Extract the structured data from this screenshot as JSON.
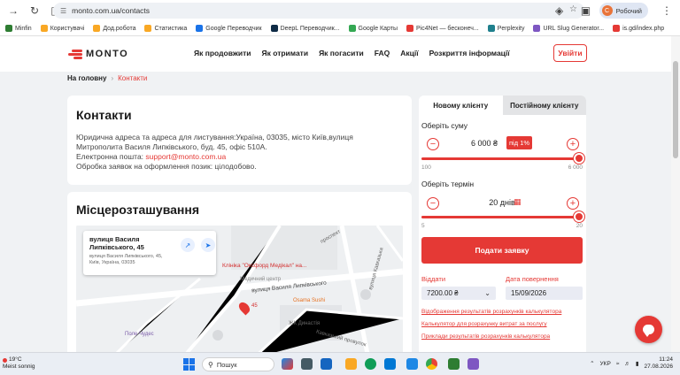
{
  "browser": {
    "url": "monto.com.ua/contacts",
    "profile_initial": "С",
    "profile_label": "Робочий"
  },
  "bookmarks": [
    {
      "label": "Minfin",
      "color": "#2e7d32"
    },
    {
      "label": "Користувачі",
      "color": "#f9a825"
    },
    {
      "label": "Дод.робота",
      "color": "#f9a825"
    },
    {
      "label": "Статистика",
      "color": "#f9a825"
    },
    {
      "label": "Google Переводчик",
      "color": "#1a73e8"
    },
    {
      "label": "DeepL Переводчик...",
      "color": "#0f2b46"
    },
    {
      "label": "Google Карты",
      "color": "#34a853"
    },
    {
      "label": "Pic4Net — бесконеч...",
      "color": "#e53935"
    },
    {
      "label": "Perplexity",
      "color": "#20808d"
    },
    {
      "label": "URL Slug Generator...",
      "color": "#7e57c2"
    },
    {
      "label": "is.gd/index.php",
      "color": "#e53935"
    }
  ],
  "header": {
    "logo_text": "MONTO",
    "nav": [
      "Як продовжити",
      "Як отримати",
      "Як погасити",
      "FAQ",
      "Акції",
      "Розкриття інформації"
    ],
    "login_label": "Увійти"
  },
  "breadcrumb": {
    "home": "На головну",
    "separator": "›",
    "current": "Контакти"
  },
  "contacts": {
    "title": "Контакти",
    "address_line1": "Юридична адреса та адреса для листування:Україна, 03035, місто Київ,вулиця",
    "address_line2": "Митрополита Василя Липківського, буд. 45, офіс 510А.",
    "email_label": "Електронна пошта: ",
    "email": "support@monto.com.ua",
    "hours": "Обробка заявок на оформлення позик: цілодобово."
  },
  "location": {
    "title": "Місцерозташування",
    "map": {
      "place_title": "вулиця Василя Липківського, 45",
      "place_address": "вулиця Василя Липківського, 45, Київ, Україна, 03035",
      "clinic": "Клініка \"Оксфорд Медікал\" на...",
      "clinic_sub": "Медичний центр",
      "street": "вулиця Василя Липківського",
      "pin_number": "45",
      "sushi": "Osama Sushi",
      "complex": "ЖК Династія",
      "field": "Поле Чудес",
      "kavkazka": "вулиця Кавказька",
      "lane": "Кавказький провулок",
      "prospect": "проспект"
    }
  },
  "calculator": {
    "tabs": [
      "Новому клієнту",
      "Постійному клієнту"
    ],
    "amount_label": "Оберіть суму",
    "amount_value": "6 000 ₴",
    "discount_badge": "під 1%",
    "amount_min": "100",
    "amount_max": "6 000",
    "amount_fraction": 1.0,
    "term_label": "Оберіть термін",
    "term_value": "20 днів",
    "term_min": "5",
    "term_max": "20",
    "term_fraction": 1.0,
    "apply_label": "Подати заявку",
    "repay_label": "Віддати",
    "repay_value": "7200.00 ₴",
    "date_label": "Дата повернення",
    "date_value": "15/09/2026",
    "links": [
      "Відображення результатів розрахунків калькулятора",
      "Калькулятор для розрахунку витрат за послугу",
      "Приклади результатів розрахунків калькулятора"
    ]
  },
  "taskbar": {
    "temperature": "19°C",
    "weather_text": "Meist sonnig",
    "search_placeholder": "Пошук",
    "language": "УКР",
    "time": "11:24",
    "date": "27.08.2026"
  },
  "colors": {
    "accent": "#e53935",
    "page_bg": "#f0f2f4"
  }
}
